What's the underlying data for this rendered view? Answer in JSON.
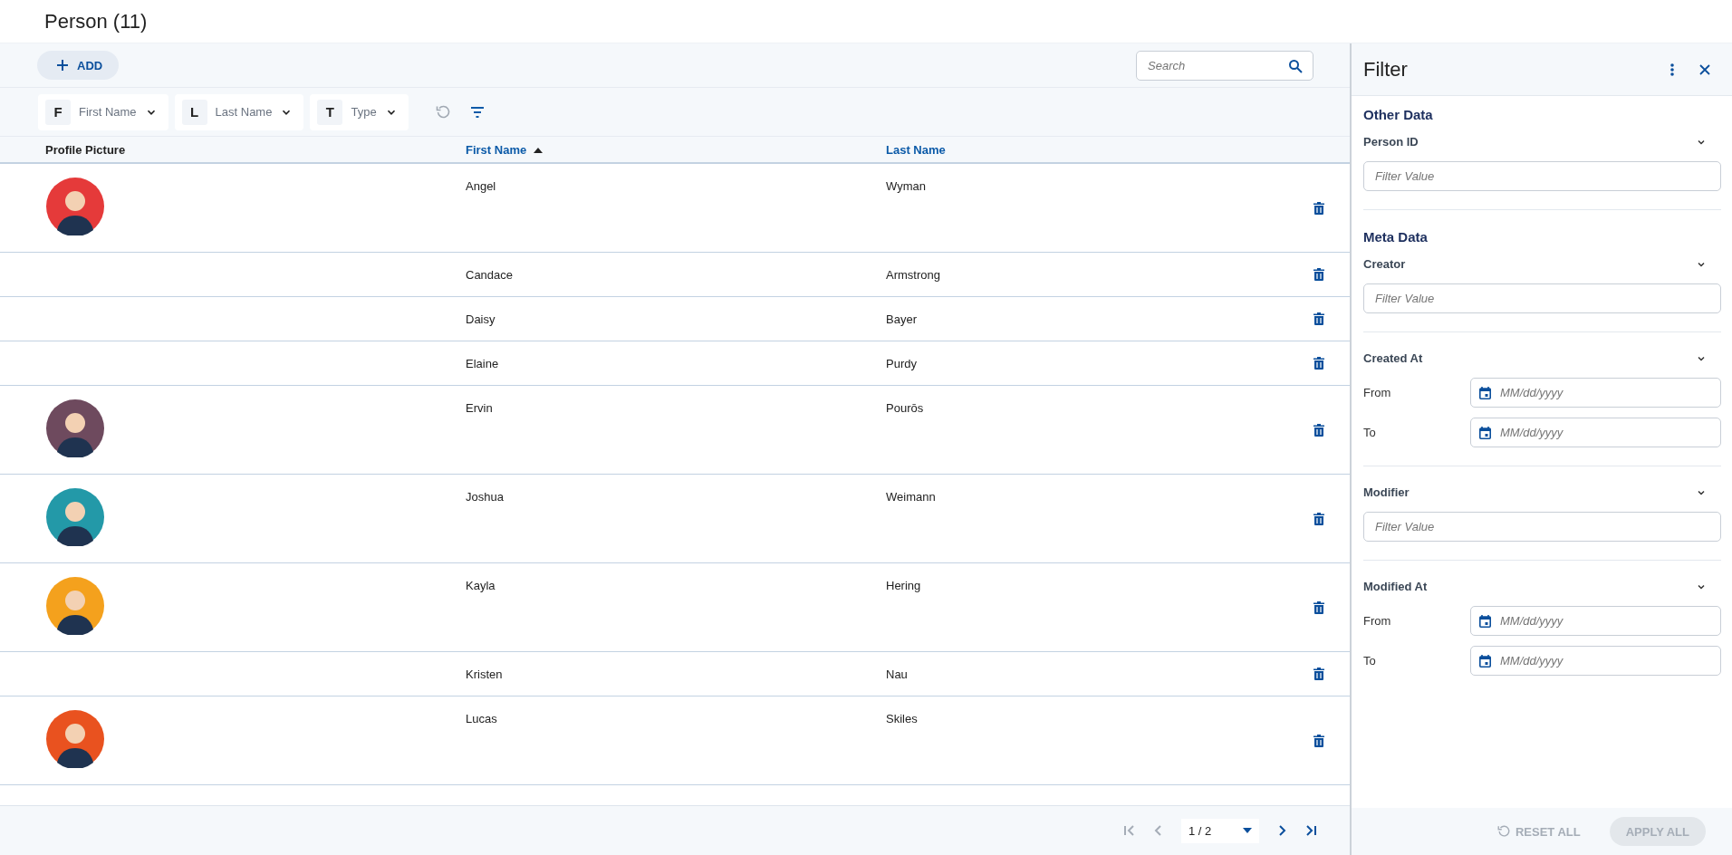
{
  "title": "Person (11)",
  "toolbar": {
    "add_button": "ADD",
    "search": {
      "placeholder": "Search"
    }
  },
  "column_filters": [
    {
      "badge": "F",
      "label": "First Name"
    },
    {
      "badge": "L",
      "label": "Last Name"
    },
    {
      "badge": "T",
      "label": "Type"
    }
  ],
  "table": {
    "columns": [
      {
        "label": "Profile Picture",
        "sortable": false,
        "sorted": false
      },
      {
        "label": "First Name",
        "sortable": true,
        "sorted": true
      },
      {
        "label": "Last Name",
        "sortable": true,
        "sorted": false
      }
    ],
    "rows": [
      {
        "has_picture": true,
        "color": "#e53a3a",
        "first_name": "Angel",
        "last_name": "Wyman"
      },
      {
        "has_picture": false,
        "first_name": "Candace",
        "last_name": "Armstrong"
      },
      {
        "has_picture": false,
        "first_name": "Daisy",
        "last_name": "Bayer"
      },
      {
        "has_picture": false,
        "first_name": "Elaine",
        "last_name": "Purdy"
      },
      {
        "has_picture": true,
        "color": "#6e4a5e",
        "first_name": "Ervin",
        "last_name": "Pourōs"
      },
      {
        "has_picture": true,
        "color": "#2399a8",
        "first_name": "Joshua",
        "last_name": "Weimann"
      },
      {
        "has_picture": true,
        "color": "#f4a11d",
        "first_name": "Kayla",
        "last_name": "Hering"
      },
      {
        "has_picture": false,
        "first_name": "Kristen",
        "last_name": "Nau"
      },
      {
        "has_picture": true,
        "color": "#e9521f",
        "first_name": "Lucas",
        "last_name": "Skiles"
      }
    ]
  },
  "pagination": {
    "page": "1 / 2",
    "before": [
      {
        "kind": "first",
        "disabled": true
      },
      {
        "kind": "prev",
        "disabled": true
      }
    ],
    "after": [
      {
        "kind": "next",
        "disabled": false
      },
      {
        "kind": "last",
        "disabled": false
      }
    ]
  },
  "filter_panel": {
    "title": "Filter",
    "sections": [
      {
        "heading": "Other Data",
        "fields": [
          {
            "kind": "text",
            "label": "Person ID",
            "placeholder": "Filter Value"
          }
        ]
      },
      {
        "heading": "Meta Data",
        "fields": [
          {
            "kind": "text",
            "label": "Creator",
            "placeholder": "Filter Value"
          },
          {
            "kind": "date_range",
            "label": "Created At",
            "from_label": "From",
            "from_placeholder": "MM/dd/yyyy",
            "to_label": "To",
            "to_placeholder": "MM/dd/yyyy"
          },
          {
            "kind": "text",
            "label": "Modifier",
            "placeholder": "Filter Value"
          },
          {
            "kind": "date_range",
            "label": "Modified At",
            "from_label": "From",
            "from_placeholder": "MM/dd/yyyy",
            "to_label": "To",
            "to_placeholder": "MM/dd/yyyy"
          }
        ]
      }
    ],
    "reset_button": {
      "label": "RESET ALL",
      "disabled": true
    },
    "apply_button": {
      "label": "APPLY ALL",
      "disabled": true
    }
  }
}
